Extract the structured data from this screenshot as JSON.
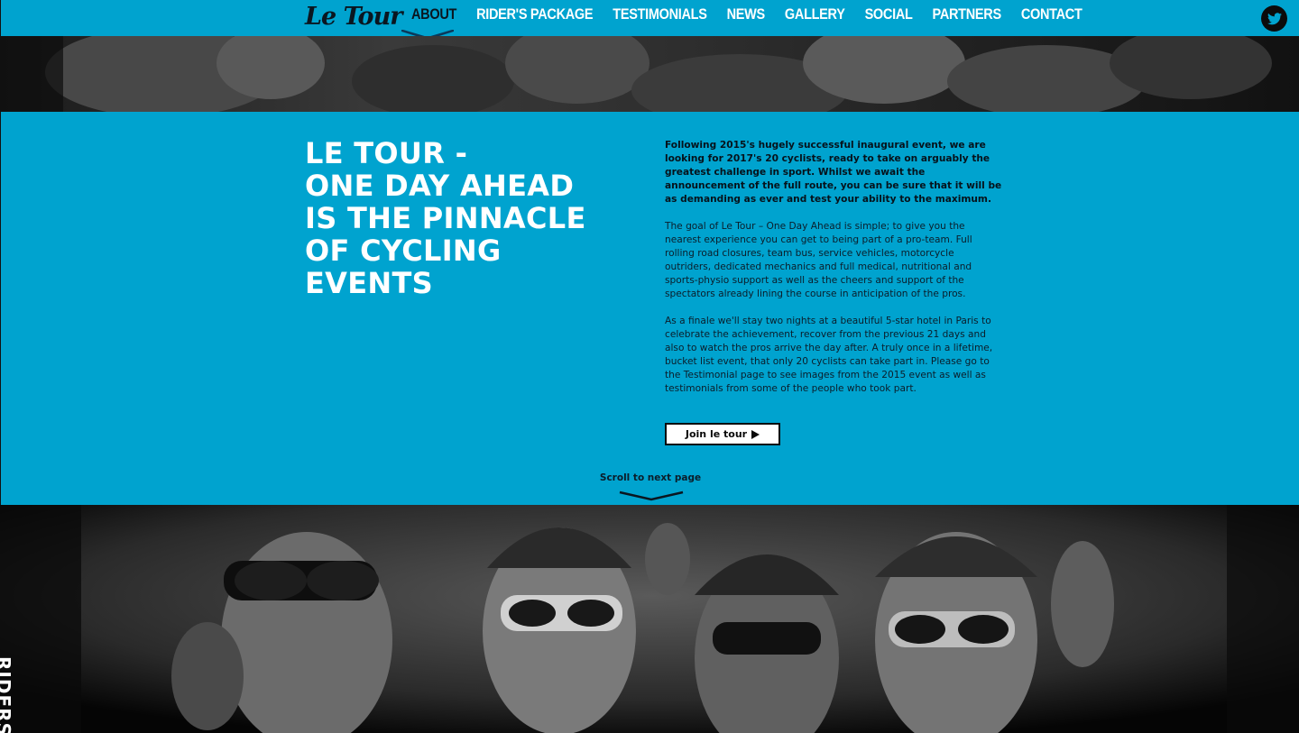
{
  "brand": {
    "logo_text": "Le Tour"
  },
  "nav": {
    "items": [
      {
        "label": "ABOUT",
        "active": true
      },
      {
        "label": "RIDER'S PACKAGE",
        "active": false
      },
      {
        "label": "TESTIMONIALS",
        "active": false
      },
      {
        "label": "NEWS",
        "active": false
      },
      {
        "label": "GALLERY",
        "active": false
      },
      {
        "label": "SOCIAL",
        "active": false
      },
      {
        "label": "PARTNERS",
        "active": false
      },
      {
        "label": "CONTACT",
        "active": false
      }
    ],
    "social_icon": "twitter-icon"
  },
  "about": {
    "headline": [
      "LE TOUR -",
      "ONE DAY AHEAD",
      "IS THE PINNACLE",
      "OF CYCLING",
      "EVENTS"
    ],
    "lead": "Following 2015's hugely successful inaugural event, we are looking for 2017's 20 cyclists, ready to take on arguably the greatest challenge in sport. Whilst we await the announcement of the full route, you can be sure that it will be as demanding as ever and test your ability to the maximum.",
    "paragraph_2": "The goal of Le Tour – One Day Ahead is simple; to give you the nearest experience you can get to being part of a pro-team. Full rolling road closures, team bus, service vehicles, motorcycle outriders, dedicated mechanics and full medical, nutritional and sports-physio support as well as the cheers and support of the spectators already lining the course in anticipation of the pros.",
    "paragraph_3": "As a finale we'll stay two nights at a beautiful 5-star hotel in Paris to celebrate the achievement, recover from the previous 21 days and also to watch the pros arrive the day after. A truly once in a lifetime, bucket list event, that only 20 cyclists can take part in. Please go to the Testimonial page to see images from the 2015 event as well as testimonials from some of the people who took part.",
    "cta_label": "Join le tour",
    "scroll_label": "Scroll to next page"
  },
  "side_label": "RIDERS",
  "colors": {
    "accent": "#00a3cf",
    "dark": "#0a1620",
    "white": "#ffffff"
  }
}
